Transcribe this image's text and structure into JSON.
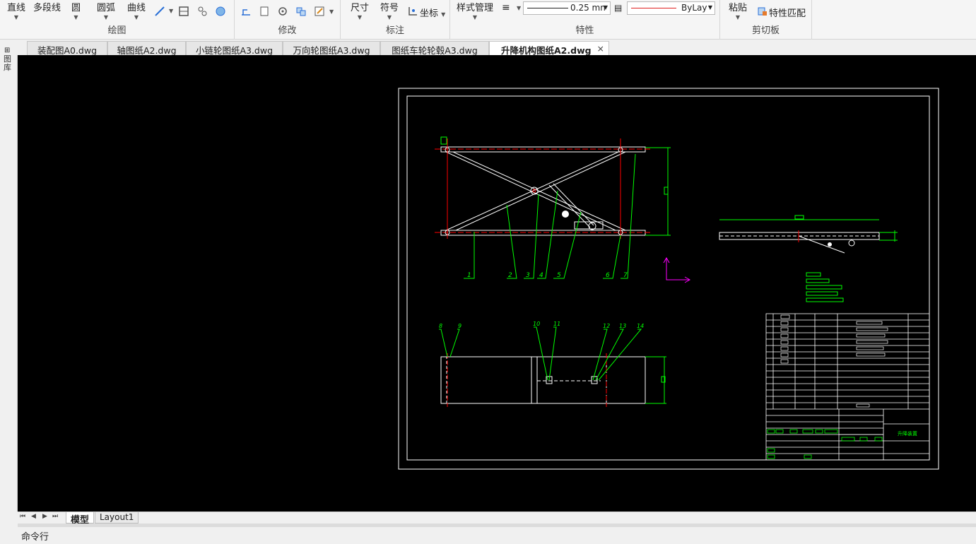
{
  "ribbon": {
    "draw": {
      "label": "绘图",
      "line": "直线",
      "polyline": "多段线",
      "circle": "圆",
      "arc": "圆弧",
      "curve": "曲线"
    },
    "modify": {
      "label": "修改"
    },
    "annotate": {
      "label": "标注",
      "dimension": "尺寸",
      "symbol": "符号",
      "coordinate": "坐标"
    },
    "properties": {
      "label": "特性",
      "style_manager": "样式管理",
      "lineweight": "0.25 mn",
      "linetype": "ByLay"
    },
    "clipboard": {
      "label": "剪切板",
      "paste": "粘贴",
      "match_properties": "特性匹配"
    }
  },
  "tabs": [
    {
      "label": "装配图A0.dwg"
    },
    {
      "label": "轴图纸A2.dwg"
    },
    {
      "label": "小链轮图纸A3.dwg"
    },
    {
      "label": "万向轮图纸A3.dwg"
    },
    {
      "label": "图纸车轮轮毂A3.dwg"
    },
    {
      "label": "升降机构图纸A2.dwg",
      "active": true,
      "close": "×"
    }
  ],
  "left_strip": {
    "label": "图库"
  },
  "drawing": {
    "balloons_top": [
      "1",
      "2",
      "3",
      "4",
      "5",
      "6",
      "7"
    ],
    "balloons_bottom": [
      "8",
      "9",
      "10",
      "11",
      "12",
      "13",
      "14"
    ],
    "title_text": "升降装置"
  },
  "layout_tabs": [
    {
      "label": "模型",
      "active": true
    },
    {
      "label": "Layout1"
    }
  ],
  "command_line": {
    "label": "命令行"
  },
  "colors": {
    "canvas": "#000000",
    "white": "#ffffff",
    "green": "#00ff00",
    "red": "#ff0000",
    "magenta": "#ff00ff"
  }
}
